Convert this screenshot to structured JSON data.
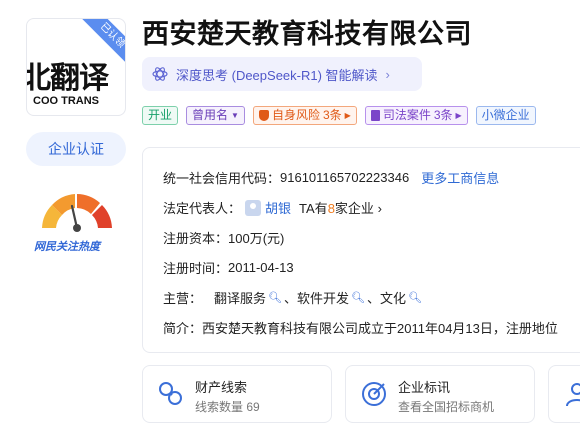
{
  "company": {
    "name": "西安楚天教育科技有限公司",
    "logo_text": "北翻译",
    "logo_sub": "COO TRANS",
    "logo_badge": "已认领"
  },
  "sidebar": {
    "cert_label": "企业认证",
    "heat_label": "网民关注热度"
  },
  "ai": {
    "label": "深度思考 (DeepSeek-R1) 智能解读",
    "chevron": "›"
  },
  "tags": {
    "open": "开业",
    "former": "曾用名",
    "risk": "自身风险",
    "risk_count": "3条",
    "case": "司法案件",
    "case_count": "3条",
    "micro": "小微企业"
  },
  "info": {
    "credit_label": "统一社会信用代码：",
    "credit_value": "916101165702223346",
    "more_link": "更多工商信息",
    "legal_label": "法定代表人：",
    "legal_name": "胡银",
    "legal_ta_prefix": "TA有",
    "legal_ta_count": "8",
    "legal_ta_suffix": "家企业",
    "capital_label": "注册资本：",
    "capital_value": "100万(元)",
    "date_label": "注册时间：",
    "date_value": "2011-04-13",
    "biz_label": "主营：",
    "biz_items": [
      "翻译服务",
      "软件开发",
      "文化"
    ],
    "intro_label": "简介：",
    "intro_text": "西安楚天教育科技有限公司成立于2011年04月13日，注册地位"
  },
  "cards": [
    {
      "title": "财产线索",
      "sub": "线索数量 69"
    },
    {
      "title": "企业标讯",
      "sub": "查看全国招标商机"
    }
  ],
  "colors": {
    "accent": "#2f6ad4",
    "purple": "#4f57c9",
    "orange": "#f07b1d"
  }
}
